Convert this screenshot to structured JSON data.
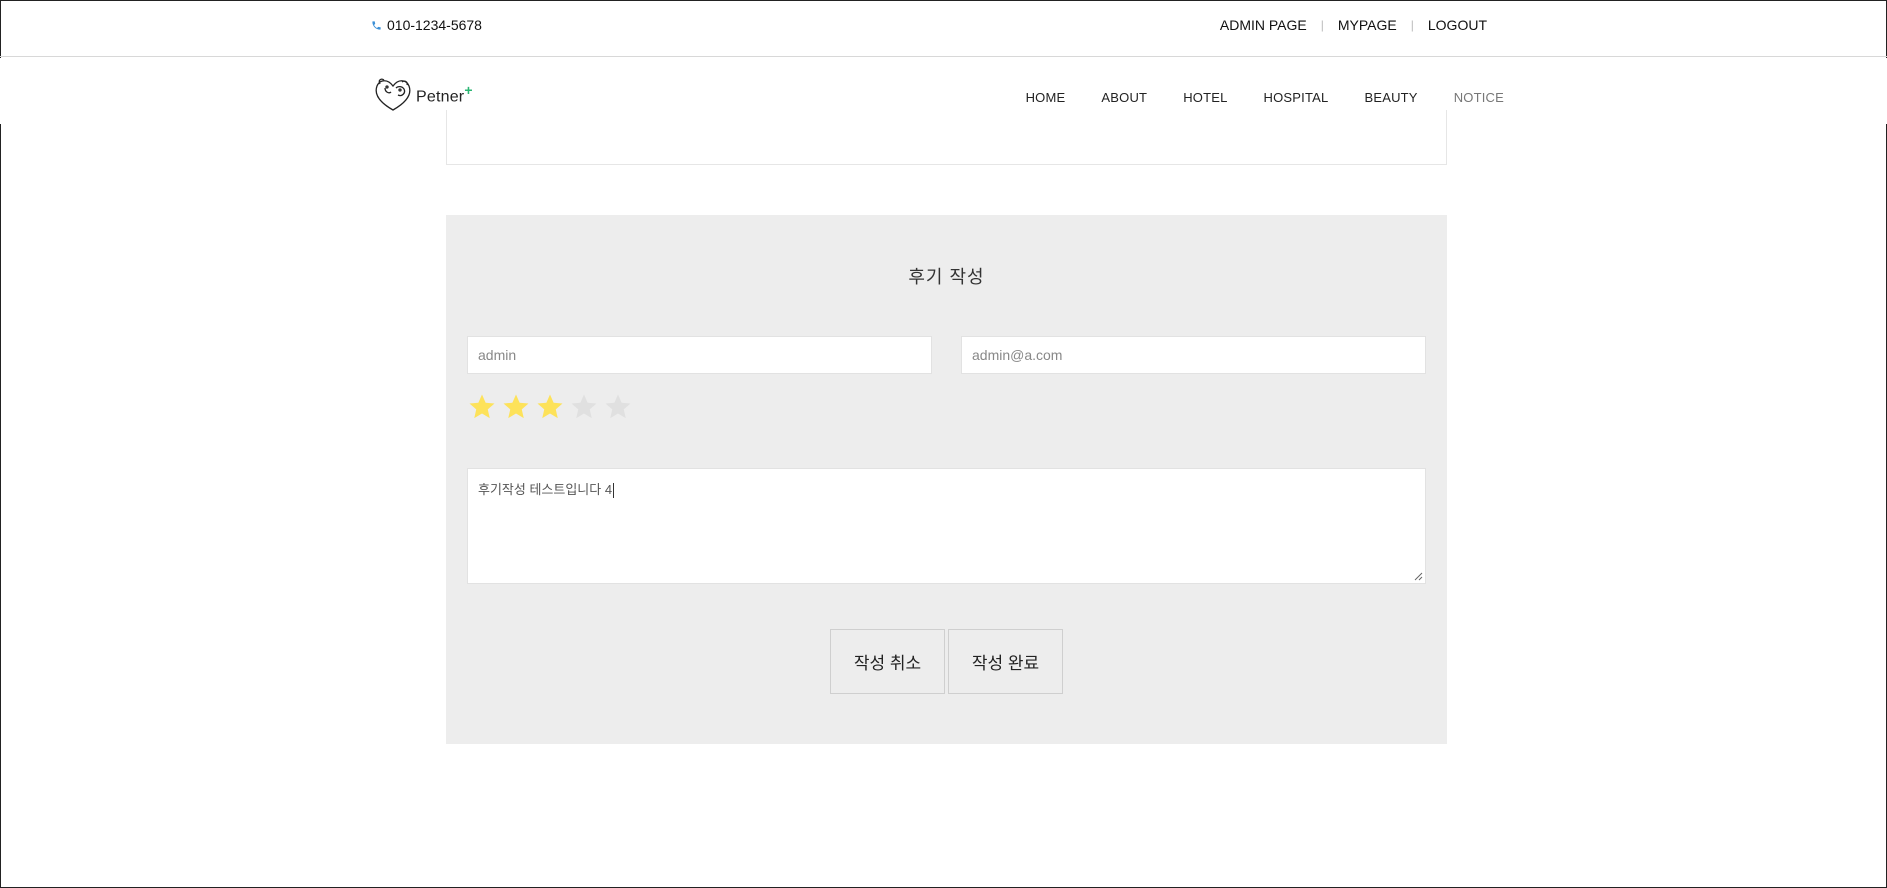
{
  "topbar": {
    "phone": "010-1234-5678",
    "links": [
      "ADMIN PAGE",
      "MYPAGE",
      "LOGOUT"
    ]
  },
  "header": {
    "logo_text": "Petner",
    "logo_plus": "+",
    "nav": [
      "HOME",
      "ABOUT",
      "HOTEL",
      "HOSPITAL",
      "BEAUTY",
      "NOTICE"
    ],
    "active_nav": "NOTICE"
  },
  "review_form": {
    "title": "후기 작성",
    "name_value": "admin",
    "email_value": "admin@a.com",
    "rating": 3,
    "rating_max": 5,
    "content_value": "후기작성 테스트입니다 4",
    "cancel_label": "작성 취소",
    "submit_label": "작성 완료"
  },
  "colors": {
    "star_filled": "#fde25a",
    "star_empty": "#e0e0e0",
    "panel_bg": "#ededed",
    "logo_plus": "#2bb673",
    "phone_icon": "#3b8fd6"
  }
}
